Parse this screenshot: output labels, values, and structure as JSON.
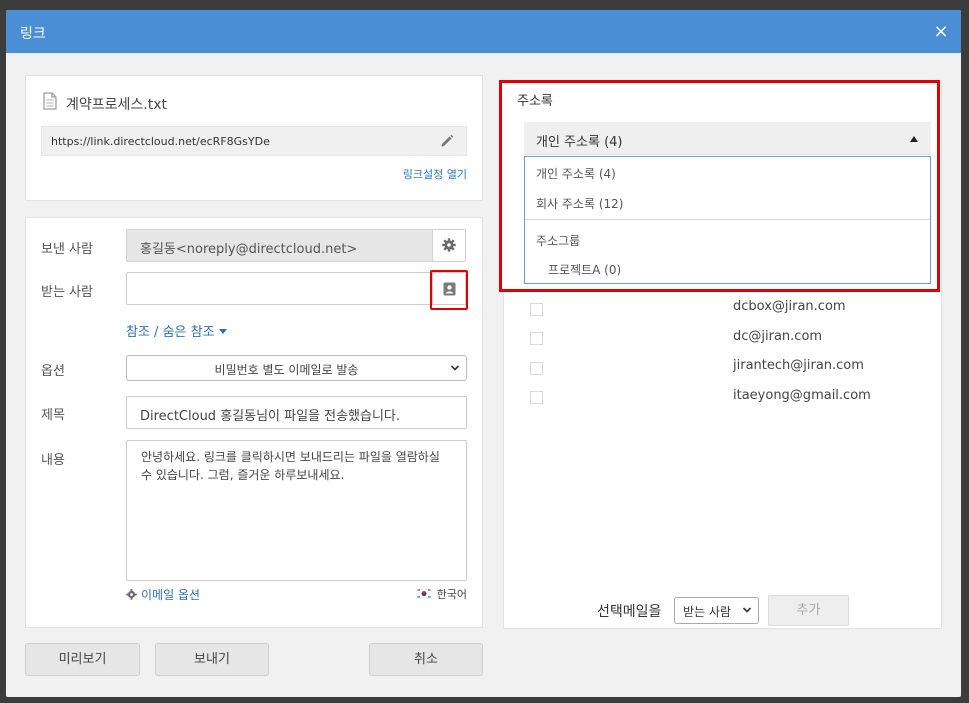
{
  "dialog": {
    "title": "링크",
    "close_icon": "×"
  },
  "file": {
    "icon": "document-icon",
    "name": "계약프로세스.txt",
    "url": "https://link.directcloud.net/ecRF8GsYDe",
    "edit_icon": "pencil-icon",
    "link_settings_label": "링크설정 열기"
  },
  "form": {
    "sender_label": "보낸 사람",
    "sender_value": "홍길동<noreply@directcloud.net>",
    "recipient_label": "받는 사람",
    "recipient_value": "",
    "cc_label": "참조 / 숨은 참조",
    "option_label": "옵션",
    "option_value": "비밀번호 별도 이메일로 발송",
    "subject_label": "제목",
    "subject_value": "DirectCloud 홍길동님이 파일을 전송했습니다.",
    "content_label": "내용",
    "content_value": "안녕하세요. 링크를 클릭하시면 보내드리는 파일을 열람하실 수 있습니다. 그럼, 즐거운 하루보내세요.",
    "email_options_label": "이메일 옵션",
    "language_label": "한국어"
  },
  "buttons": {
    "preview": "미리보기",
    "send": "보내기",
    "cancel": "취소"
  },
  "address_book": {
    "title": "주소록",
    "selected": "개인 주소록 (4)",
    "options": {
      "personal": "개인 주소록 (4)",
      "company": "회사 주소록 (12)",
      "group_header": "주소그룹",
      "group_item": "프로젝트A (0)"
    },
    "emails": [
      "dcbox@jiran.com",
      "dc@jiran.com",
      "jirantech@jiran.com",
      "itaeyong@gmail.com"
    ],
    "selected_mail_label": "선택메일을",
    "target_value": "받는 사람",
    "add_label": "추가"
  },
  "colors": {
    "titlebar": "#4a8fd6",
    "highlight": "#e00000",
    "link": "#2f6fb7"
  }
}
